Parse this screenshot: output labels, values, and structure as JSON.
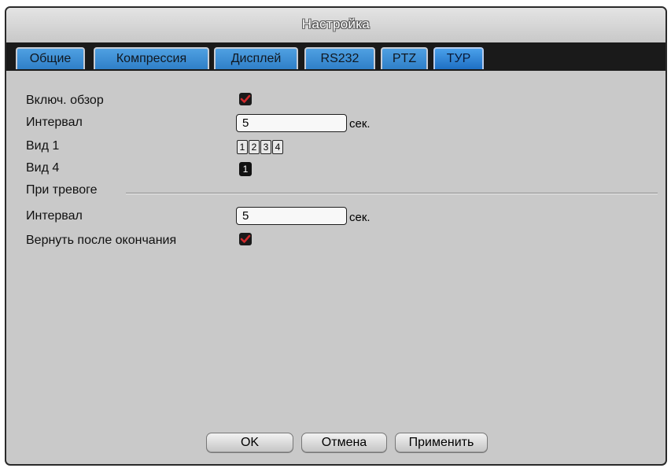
{
  "window": {
    "title": "Настройка"
  },
  "tabs": [
    {
      "label": "Общие"
    },
    {
      "label": "Компрессия"
    },
    {
      "label": "Дисплей"
    },
    {
      "label": "RS232"
    },
    {
      "label": "PTZ"
    },
    {
      "label": "ТУР",
      "active": true
    }
  ],
  "form": {
    "enable_tour": {
      "label": "Включ. обзор",
      "checked": true
    },
    "interval": {
      "label": "Интервал",
      "value": "5",
      "unit": "сек."
    },
    "view1": {
      "label": "Вид 1",
      "options": [
        "1",
        "2",
        "3",
        "4"
      ]
    },
    "view4": {
      "label": "Вид 4",
      "options": [
        "1"
      ]
    },
    "on_alarm": {
      "label": "При тревоге"
    },
    "alarm_interval": {
      "label": "Интервал",
      "value": "5",
      "unit": "сек."
    },
    "return_after": {
      "label": "Вернуть после окончания",
      "checked": true
    }
  },
  "buttons": {
    "ok": "OK",
    "cancel": "Отмена",
    "apply": "Применить"
  },
  "colors": {
    "tab_blue": "#2f7fc8",
    "check_red": "#c0282a",
    "panel": "#c9c9c9"
  },
  "icons": {
    "checkbox": "checkmark-icon"
  }
}
